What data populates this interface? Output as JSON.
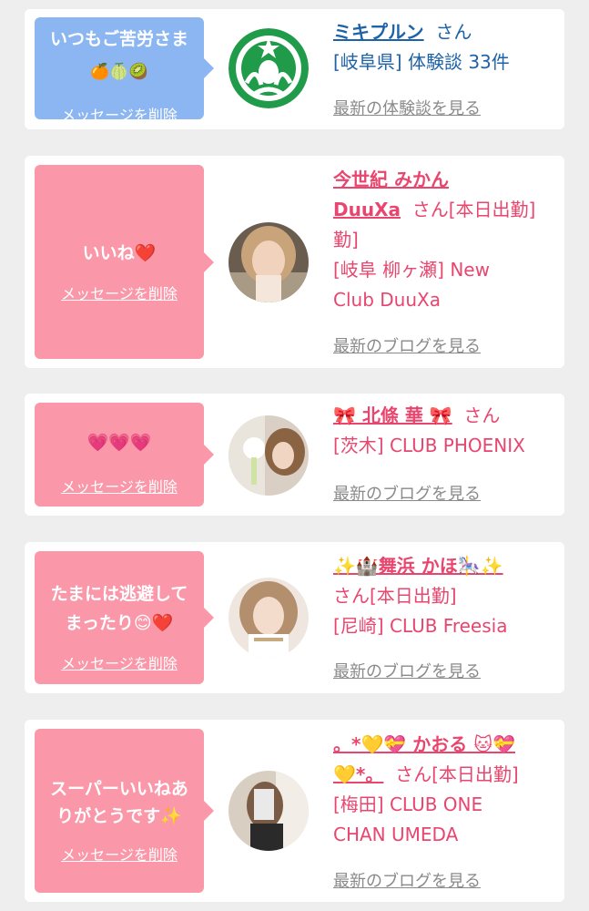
{
  "delete_label": "メッセージを削除",
  "items": [
    {
      "message": "いつもご苦労さま",
      "message_emoji": "🍊🍈🥝",
      "name": "ミキプルン",
      "san": "さん",
      "details": [
        "[岐阜県] 体験談 33件"
      ],
      "link": "最新の体験談を見る"
    },
    {
      "message": "いいね❤️",
      "name_lines": [
        "今世紀 みかん",
        "DuuXa"
      ],
      "san": "さん[本日出勤]",
      "details": [
        "[岐阜 柳ヶ瀬] New",
        "Club DuuXa"
      ],
      "link": "最新のブログを見る"
    },
    {
      "message": "💗💗💗",
      "name": "🎀 北條 華 🎀",
      "san": "さん",
      "details": [
        "[茨木] CLUB PHOENIX"
      ],
      "link": "最新のブログを見る"
    },
    {
      "message_lines": [
        "たまには逃避して",
        "まったり😊❤️"
      ],
      "name": "✨🏰舞浜 かほ🎠✨",
      "san": "さん[本日出勤]",
      "details": [
        "[尼崎] CLUB Freesia"
      ],
      "link": "最新のブログを見る"
    },
    {
      "message_lines": [
        "スーパーいいねあ",
        "りがとうです✨"
      ],
      "name_lines": [
        "。*💛💝 かおる 🐱💝",
        "💛*。"
      ],
      "san": "さん[本日出勤]",
      "details": [
        "[梅田] CLUB ONE",
        "CHAN UMEDA"
      ],
      "link": "最新のブログを見る"
    }
  ]
}
